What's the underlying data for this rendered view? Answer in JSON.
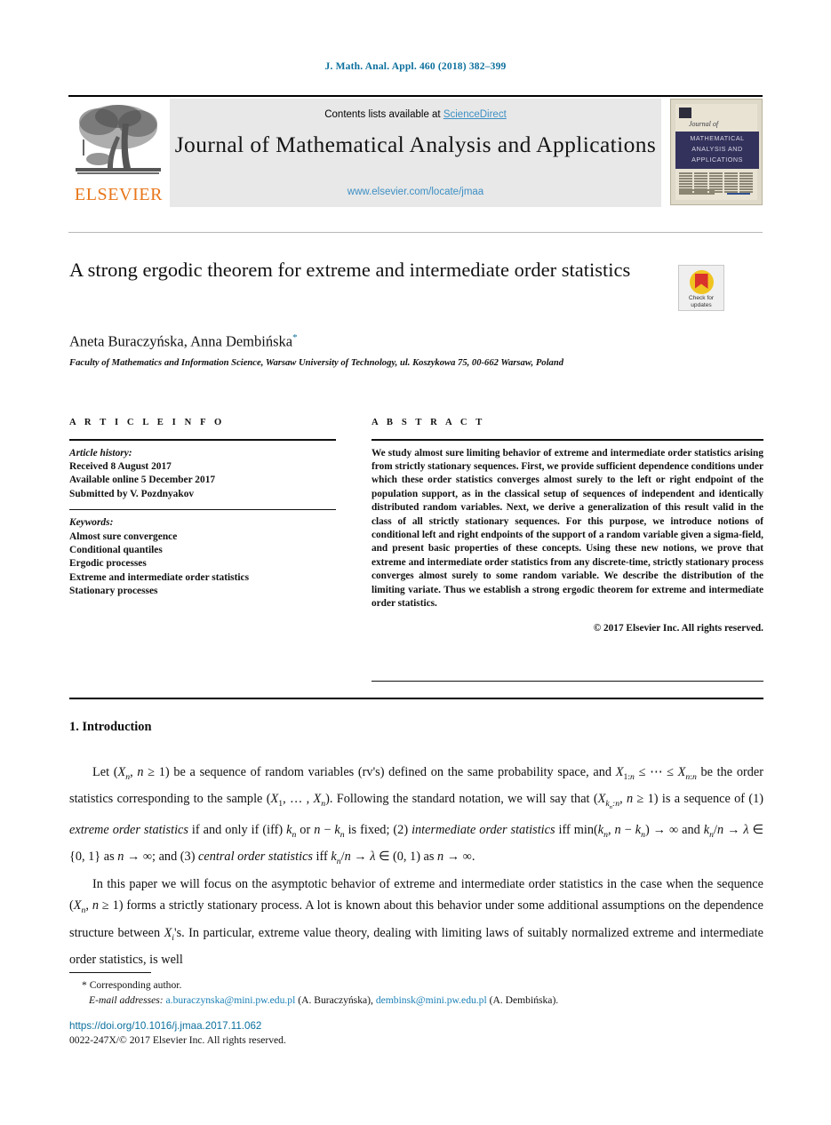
{
  "running_head": "J. Math. Anal. Appl. 460 (2018) 382–399",
  "masthead": {
    "contents_prefix": "Contents lists available at ",
    "sciencedirect": "ScienceDirect",
    "journal_title": "Journal of Mathematical Analysis and Applications",
    "journal_url": "www.elsevier.com/locate/jmaa",
    "publisher": "ELSEVIER",
    "cover": {
      "script": "Journal of",
      "line1": "MATHEMATICAL",
      "line2": "ANALYSIS AND",
      "line3": "APPLICATIONS"
    }
  },
  "article": {
    "title": "A strong ergodic theorem for extreme and intermediate order statistics",
    "authors": "Aneta Buraczyńska, Anna Dembińska",
    "author_marker": "*",
    "affiliation": "Faculty of Mathematics and Information Science, Warsaw University of Technology, ul. Koszykowa 75, 00-662 Warsaw, Poland"
  },
  "crossmark": {
    "line1": "Check for",
    "line2": "updates"
  },
  "info": {
    "heading": "A R T I C L E   I N F O",
    "history_label": "Article history:",
    "received": "Received 8 August 2017",
    "available": "Available online 5 December 2017",
    "submitted": "Submitted by V. Pozdnyakov",
    "keywords_label": "Keywords:",
    "keywords": [
      "Almost sure convergence",
      "Conditional quantiles",
      "Ergodic processes",
      "Extreme and intermediate order statistics",
      "Stationary processes"
    ]
  },
  "abstract": {
    "heading": "A B S T R A C T",
    "text": "We study almost sure limiting behavior of extreme and intermediate order statistics arising from strictly stationary sequences. First, we provide sufficient dependence conditions under which these order statistics converges almost surely to the left or right endpoint of the population support, as in the classical setup of sequences of independent and identically distributed random variables. Next, we derive a generalization of this result valid in the class of all strictly stationary sequences. For this purpose, we introduce notions of conditional left and right endpoints of the support of a random variable given a sigma-field, and present basic properties of these concepts. Using these new notions, we prove that extreme and intermediate order statistics from any discrete-time, strictly stationary process converges almost surely to some random variable. We describe the distribution of the limiting variate. Thus we establish a strong ergodic theorem for extreme and intermediate order statistics.",
    "copyright": "© 2017 Elsevier Inc. All rights reserved."
  },
  "body": {
    "section_heading": "1. Introduction",
    "para1_a": "Let (X",
    "para1": "Let (Xn, n ≥ 1) be a sequence of random variables (rv's) defined on the same probability space, and X1:n ≤ ⋯ ≤ Xn:n be the order statistics corresponding to the sample (X1, …, Xn). Following the standard notation, we will say that (Xkn:n, n ≥ 1) is a sequence of (1) extreme order statistics if and only if (iff) kn or n − kn is fixed; (2) intermediate order statistics iff min(kn, n − kn) → ∞ and kn/n → λ ∈ {0, 1} as n → ∞; and (3) central order statistics iff kn/n → λ ∈ (0, 1) as n → ∞.",
    "para2": "In this paper we will focus on the asymptotic behavior of extreme and intermediate order statistics in the case when the sequence (Xn, n ≥ 1) forms a strictly stationary process. A lot is known about this behavior under some additional assumptions on the dependence structure between Xi's. In particular, extreme value theory, dealing with limiting laws of suitably normalized extreme and intermediate order statistics, is well"
  },
  "footnote": {
    "marker": "*",
    "corresponding": "Corresponding author.",
    "email_label": "E-mail addresses:",
    "email1": "a.buraczynska@mini.pw.edu.pl",
    "email1_author": "(A. Buraczyńska),",
    "email2": "dembinsk@mini.pw.edu.pl",
    "email2_author": "(A. Dembińska)."
  },
  "bottom": {
    "doi": "https://doi.org/10.1016/j.jmaa.2017.11.062",
    "issn": "0022-247X/© 2017 Elsevier Inc. All rights reserved."
  },
  "colors": {
    "link_blue": "#0b6f9d",
    "sciencedirect_blue": "#3d8fc4",
    "elsevier_orange": "#e8761a",
    "cover_band": "#33325c",
    "crossmark_yellow": "#f0c420",
    "crossmark_red": "#d9312b"
  }
}
